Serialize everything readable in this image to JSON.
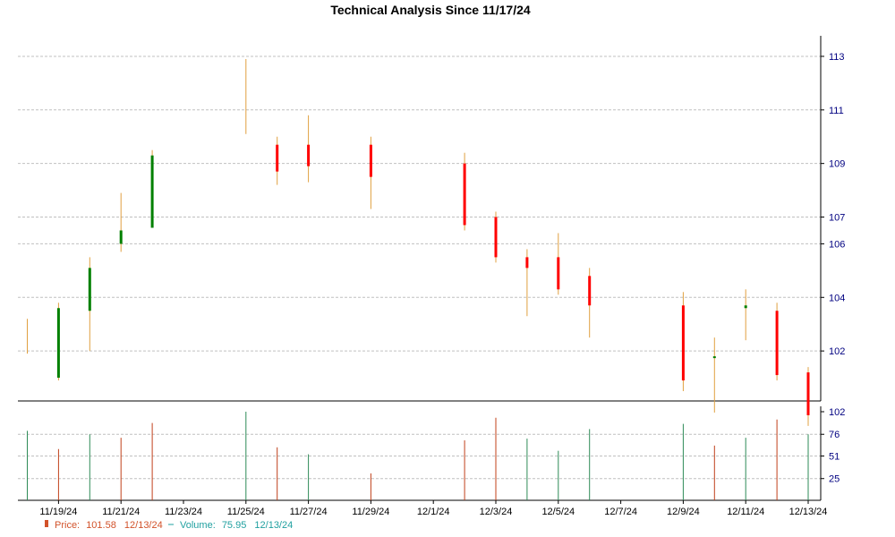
{
  "chart_data": {
    "type": "candlestick",
    "title": "Technical Analysis Since 11/17/24",
    "price_axis": {
      "range": [
        100.2,
        113.5
      ],
      "ticks": [
        102,
        104,
        106,
        107,
        109,
        111,
        113
      ]
    },
    "volume_axis": {
      "range": [
        0,
        102
      ],
      "ticks": [
        25,
        51,
        76,
        102
      ]
    },
    "x_ticks": [
      {
        "day": 2,
        "label": "11/19/24"
      },
      {
        "day": 4,
        "label": "11/21/24"
      },
      {
        "day": 6,
        "label": "11/23/24"
      },
      {
        "day": 8,
        "label": "11/25/24"
      },
      {
        "day": 10,
        "label": "11/27/24"
      },
      {
        "day": 12,
        "label": "11/29/24"
      },
      {
        "day": 14,
        "label": "12/1/24"
      },
      {
        "day": 16,
        "label": "12/3/24"
      },
      {
        "day": 18,
        "label": "12/5/24"
      },
      {
        "day": 20,
        "label": "12/7/24"
      },
      {
        "day": 22,
        "label": "12/9/24"
      },
      {
        "day": 24,
        "label": "12/11/24"
      },
      {
        "day": 26,
        "label": "12/13/24"
      }
    ],
    "candles": [
      {
        "day": 1,
        "open": null,
        "close": null,
        "high": 103.2,
        "low": 101.9
      },
      {
        "day": 2,
        "open": 101.0,
        "close": 103.6,
        "high": 103.8,
        "low": 100.9
      },
      {
        "day": 3,
        "open": 103.5,
        "close": 105.1,
        "high": 105.5,
        "low": 102.0
      },
      {
        "day": 4,
        "open": 106.0,
        "close": 106.5,
        "high": 107.9,
        "low": 105.7
      },
      {
        "day": 5,
        "open": 106.6,
        "close": 109.3,
        "high": 109.5,
        "low": 106.6
      },
      {
        "day": 8,
        "open": null,
        "close": null,
        "high": 112.9,
        "low": 110.1
      },
      {
        "day": 9,
        "open": 109.7,
        "close": 108.7,
        "high": 110.0,
        "low": 108.2
      },
      {
        "day": 10,
        "open": 109.7,
        "close": 108.9,
        "high": 110.8,
        "low": 108.3
      },
      {
        "day": 12,
        "open": 109.7,
        "close": 108.5,
        "high": 110.0,
        "low": 107.3
      },
      {
        "day": 15,
        "open": 109.0,
        "close": 106.7,
        "high": 109.4,
        "low": 106.5
      },
      {
        "day": 16,
        "open": 107.0,
        "close": 105.5,
        "high": 107.2,
        "low": 105.3
      },
      {
        "day": 17,
        "open": 105.5,
        "close": 105.1,
        "high": 105.8,
        "low": 103.3
      },
      {
        "day": 18,
        "open": 105.5,
        "close": 104.3,
        "high": 106.4,
        "low": 104.1
      },
      {
        "day": 19,
        "open": 104.8,
        "close": 103.7,
        "high": 105.1,
        "low": 102.5
      },
      {
        "day": 22,
        "open": 103.7,
        "close": 100.9,
        "high": 104.2,
        "low": 100.5
      },
      {
        "day": 23,
        "open": 101.8,
        "close": 101.8,
        "high": 102.5,
        "low": 99.7
      },
      {
        "day": 24,
        "open": 103.6,
        "close": 103.7,
        "high": 104.3,
        "low": 102.4
      },
      {
        "day": 25,
        "open": 103.5,
        "close": 101.1,
        "high": 103.8,
        "low": 100.9
      },
      {
        "day": 26,
        "open": 101.2,
        "close": 99.6,
        "high": 101.4,
        "low": 99.2
      }
    ],
    "volumes": [
      {
        "day": 1,
        "value": 80,
        "dir": "up"
      },
      {
        "day": 2,
        "value": 59,
        "dir": "down"
      },
      {
        "day": 3,
        "value": 76,
        "dir": "up"
      },
      {
        "day": 4,
        "value": 72,
        "dir": "down"
      },
      {
        "day": 5,
        "value": 89,
        "dir": "down"
      },
      {
        "day": 8,
        "value": 102,
        "dir": "up"
      },
      {
        "day": 9,
        "value": 61,
        "dir": "down"
      },
      {
        "day": 10,
        "value": 53,
        "dir": "up"
      },
      {
        "day": 12,
        "value": 31,
        "dir": "down"
      },
      {
        "day": 15,
        "value": 69,
        "dir": "down"
      },
      {
        "day": 16,
        "value": 95,
        "dir": "down"
      },
      {
        "day": 17,
        "value": 71,
        "dir": "up"
      },
      {
        "day": 18,
        "value": 57,
        "dir": "up"
      },
      {
        "day": 19,
        "value": 82,
        "dir": "up"
      },
      {
        "day": 22,
        "value": 88,
        "dir": "up"
      },
      {
        "day": 23,
        "value": 63,
        "dir": "down"
      },
      {
        "day": 24,
        "value": 72,
        "dir": "up"
      },
      {
        "day": 25,
        "value": 93,
        "dir": "down"
      },
      {
        "day": 26,
        "value": 76,
        "dir": "up"
      }
    ],
    "colors": {
      "up": "#008000",
      "down": "#ff0000",
      "wick": "#e0a040",
      "vol_up": "#2e8b57",
      "vol_down": "#c0401a",
      "grid": "#c0c0c0",
      "axis_label": "#000080"
    },
    "legend": {
      "price_label": "Price:",
      "price_value": "101.58",
      "price_date": "12/13/24",
      "volume_label": "Volume:",
      "volume_value": "75.95",
      "volume_date": "12/13/24",
      "price_color": "#d2522a",
      "volume_color": "#20a0a0"
    }
  }
}
